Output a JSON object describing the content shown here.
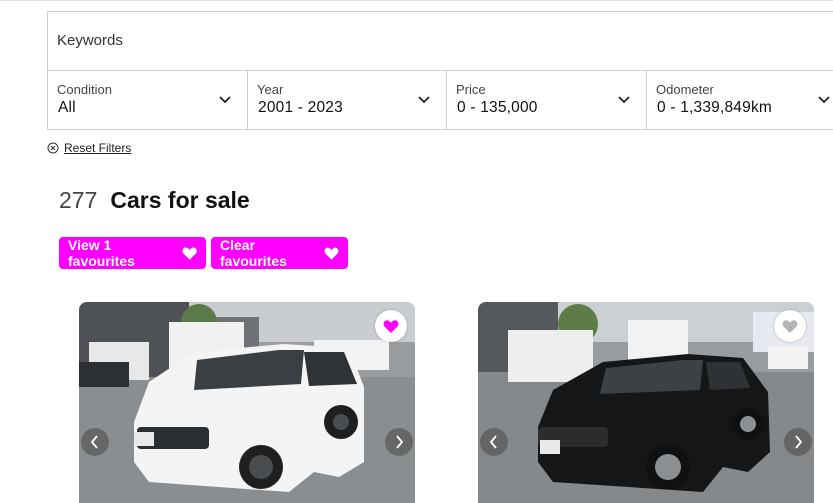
{
  "search": {
    "keywords_placeholder": "Keywords"
  },
  "filters": [
    {
      "label": "Condition",
      "value": "All"
    },
    {
      "label": "Year",
      "value": "2001 - 2023"
    },
    {
      "label": "Price",
      "value": "0 - 135,000"
    },
    {
      "label": "Odometer",
      "value": "0 - 1,339,849km"
    }
  ],
  "reset_label": "Reset Filters",
  "results": {
    "count": "277",
    "title": "Cars for sale"
  },
  "favourites": {
    "view_label": "View 1 favourites",
    "clear_label": "Clear favourites"
  },
  "colors": {
    "accent": "#ff00ff",
    "border": "#cfcfcf"
  },
  "cards": [
    {
      "car_color": "white",
      "favourited": true,
      "icon": "heart-icon"
    },
    {
      "car_color": "black",
      "favourited": false,
      "icon": "heart-icon"
    }
  ]
}
